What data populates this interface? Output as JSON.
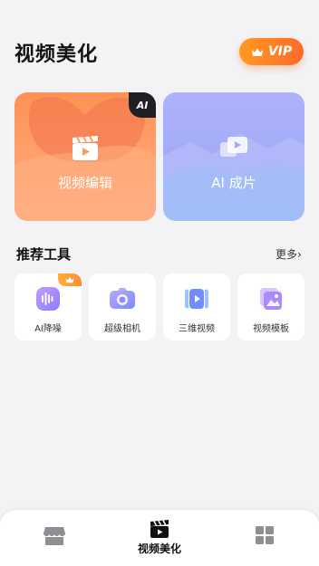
{
  "header": {
    "title": "视频美化",
    "vip_label": "VIP"
  },
  "cards": {
    "edit_label": "视频编辑",
    "ai_label": "AI 成片",
    "ai_badge": "AI"
  },
  "tools": {
    "section_title": "推荐工具",
    "more_label": "更多",
    "items": [
      {
        "label": "AI降噪",
        "icon": "ai-denoise-icon",
        "vip": true
      },
      {
        "label": "超级相机",
        "icon": "camera-icon",
        "vip": false
      },
      {
        "label": "三维视频",
        "icon": "3d-video-icon",
        "vip": false
      },
      {
        "label": "视频模板",
        "icon": "template-icon",
        "vip": false
      }
    ]
  },
  "tabbar": {
    "tabs": [
      {
        "label": "",
        "icon": "store-icon"
      },
      {
        "label": "视频美化",
        "icon": "clapper-icon",
        "active": true
      },
      {
        "label": "",
        "icon": "grid-icon"
      }
    ]
  },
  "colors": {
    "accent": "#ff7a2a",
    "edit_card": "#ff9a5e",
    "ai_card": "#a3abf8"
  }
}
